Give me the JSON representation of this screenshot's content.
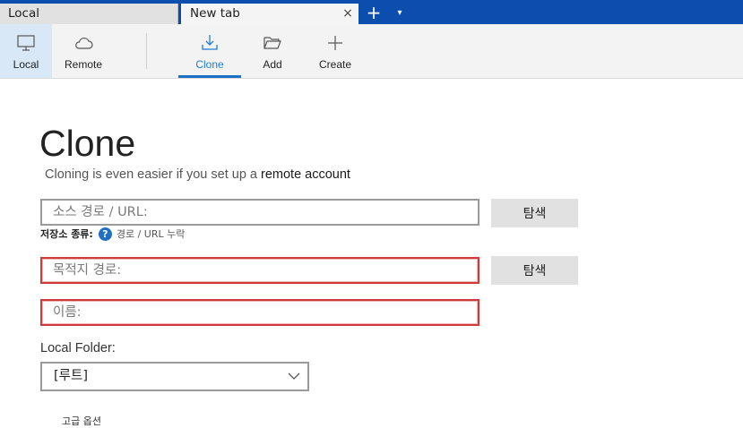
{
  "tabs": [
    {
      "label": "Local"
    },
    {
      "label": "New tab",
      "close": "×"
    }
  ],
  "tabstrip": {
    "new_tab": "+",
    "dropdown": "▾"
  },
  "toolbar": {
    "local": {
      "label": "Local",
      "icon": "monitor-icon"
    },
    "remote": {
      "label": "Remote",
      "icon": "cloud-icon"
    },
    "clone": {
      "label": "Clone",
      "icon": "download-icon"
    },
    "add": {
      "label": "Add",
      "icon": "folder-open-icon"
    },
    "create": {
      "label": "Create",
      "icon": "plus-icon"
    }
  },
  "clone": {
    "title": "Clone",
    "subtitle_prefix": "Cloning is even easier if you set up a ",
    "subtitle_link": "remote account",
    "source_placeholder": "소스 경로 / URL:",
    "browse_label": "탐색",
    "repo_type_label": "저장소 종류:",
    "repo_type_help": "?",
    "repo_type_value": "경로 / URL 누락",
    "destination_placeholder": "목적지 경로:",
    "name_placeholder": "이름:",
    "local_folder_label": "Local Folder:",
    "local_folder_value": "[루트]",
    "cutoff_text": "고급 옵션"
  },
  "colors": {
    "tabstrip": "#0b4eae",
    "accent": "#1f7cd6",
    "invalid_border": "#cf3b3b",
    "toolbar_bg": "#f3f3f3",
    "selected_nav": "#d9e8f7"
  }
}
